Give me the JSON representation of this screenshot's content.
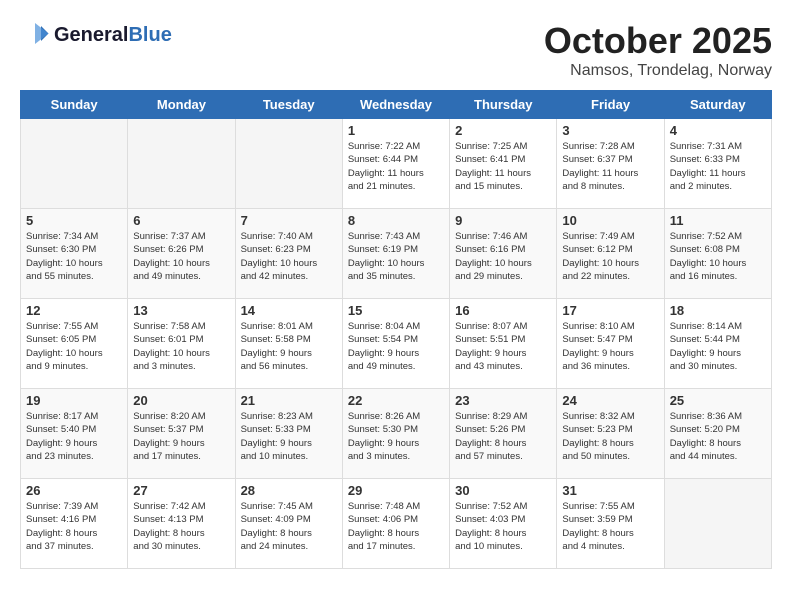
{
  "header": {
    "logo_line1": "General",
    "logo_line2": "Blue",
    "month": "October 2025",
    "location": "Namsos, Trondelag, Norway"
  },
  "weekdays": [
    "Sunday",
    "Monday",
    "Tuesday",
    "Wednesday",
    "Thursday",
    "Friday",
    "Saturday"
  ],
  "weeks": [
    [
      {
        "day": "",
        "info": ""
      },
      {
        "day": "",
        "info": ""
      },
      {
        "day": "",
        "info": ""
      },
      {
        "day": "1",
        "info": "Sunrise: 7:22 AM\nSunset: 6:44 PM\nDaylight: 11 hours\nand 21 minutes."
      },
      {
        "day": "2",
        "info": "Sunrise: 7:25 AM\nSunset: 6:41 PM\nDaylight: 11 hours\nand 15 minutes."
      },
      {
        "day": "3",
        "info": "Sunrise: 7:28 AM\nSunset: 6:37 PM\nDaylight: 11 hours\nand 8 minutes."
      },
      {
        "day": "4",
        "info": "Sunrise: 7:31 AM\nSunset: 6:33 PM\nDaylight: 11 hours\nand 2 minutes."
      }
    ],
    [
      {
        "day": "5",
        "info": "Sunrise: 7:34 AM\nSunset: 6:30 PM\nDaylight: 10 hours\nand 55 minutes."
      },
      {
        "day": "6",
        "info": "Sunrise: 7:37 AM\nSunset: 6:26 PM\nDaylight: 10 hours\nand 49 minutes."
      },
      {
        "day": "7",
        "info": "Sunrise: 7:40 AM\nSunset: 6:23 PM\nDaylight: 10 hours\nand 42 minutes."
      },
      {
        "day": "8",
        "info": "Sunrise: 7:43 AM\nSunset: 6:19 PM\nDaylight: 10 hours\nand 35 minutes."
      },
      {
        "day": "9",
        "info": "Sunrise: 7:46 AM\nSunset: 6:16 PM\nDaylight: 10 hours\nand 29 minutes."
      },
      {
        "day": "10",
        "info": "Sunrise: 7:49 AM\nSunset: 6:12 PM\nDaylight: 10 hours\nand 22 minutes."
      },
      {
        "day": "11",
        "info": "Sunrise: 7:52 AM\nSunset: 6:08 PM\nDaylight: 10 hours\nand 16 minutes."
      }
    ],
    [
      {
        "day": "12",
        "info": "Sunrise: 7:55 AM\nSunset: 6:05 PM\nDaylight: 10 hours\nand 9 minutes."
      },
      {
        "day": "13",
        "info": "Sunrise: 7:58 AM\nSunset: 6:01 PM\nDaylight: 10 hours\nand 3 minutes."
      },
      {
        "day": "14",
        "info": "Sunrise: 8:01 AM\nSunset: 5:58 PM\nDaylight: 9 hours\nand 56 minutes."
      },
      {
        "day": "15",
        "info": "Sunrise: 8:04 AM\nSunset: 5:54 PM\nDaylight: 9 hours\nand 49 minutes."
      },
      {
        "day": "16",
        "info": "Sunrise: 8:07 AM\nSunset: 5:51 PM\nDaylight: 9 hours\nand 43 minutes."
      },
      {
        "day": "17",
        "info": "Sunrise: 8:10 AM\nSunset: 5:47 PM\nDaylight: 9 hours\nand 36 minutes."
      },
      {
        "day": "18",
        "info": "Sunrise: 8:14 AM\nSunset: 5:44 PM\nDaylight: 9 hours\nand 30 minutes."
      }
    ],
    [
      {
        "day": "19",
        "info": "Sunrise: 8:17 AM\nSunset: 5:40 PM\nDaylight: 9 hours\nand 23 minutes."
      },
      {
        "day": "20",
        "info": "Sunrise: 8:20 AM\nSunset: 5:37 PM\nDaylight: 9 hours\nand 17 minutes."
      },
      {
        "day": "21",
        "info": "Sunrise: 8:23 AM\nSunset: 5:33 PM\nDaylight: 9 hours\nand 10 minutes."
      },
      {
        "day": "22",
        "info": "Sunrise: 8:26 AM\nSunset: 5:30 PM\nDaylight: 9 hours\nand 3 minutes."
      },
      {
        "day": "23",
        "info": "Sunrise: 8:29 AM\nSunset: 5:26 PM\nDaylight: 8 hours\nand 57 minutes."
      },
      {
        "day": "24",
        "info": "Sunrise: 8:32 AM\nSunset: 5:23 PM\nDaylight: 8 hours\nand 50 minutes."
      },
      {
        "day": "25",
        "info": "Sunrise: 8:36 AM\nSunset: 5:20 PM\nDaylight: 8 hours\nand 44 minutes."
      }
    ],
    [
      {
        "day": "26",
        "info": "Sunrise: 7:39 AM\nSunset: 4:16 PM\nDaylight: 8 hours\nand 37 minutes."
      },
      {
        "day": "27",
        "info": "Sunrise: 7:42 AM\nSunset: 4:13 PM\nDaylight: 8 hours\nand 30 minutes."
      },
      {
        "day": "28",
        "info": "Sunrise: 7:45 AM\nSunset: 4:09 PM\nDaylight: 8 hours\nand 24 minutes."
      },
      {
        "day": "29",
        "info": "Sunrise: 7:48 AM\nSunset: 4:06 PM\nDaylight: 8 hours\nand 17 minutes."
      },
      {
        "day": "30",
        "info": "Sunrise: 7:52 AM\nSunset: 4:03 PM\nDaylight: 8 hours\nand 10 minutes."
      },
      {
        "day": "31",
        "info": "Sunrise: 7:55 AM\nSunset: 3:59 PM\nDaylight: 8 hours\nand 4 minutes."
      },
      {
        "day": "",
        "info": ""
      }
    ]
  ]
}
